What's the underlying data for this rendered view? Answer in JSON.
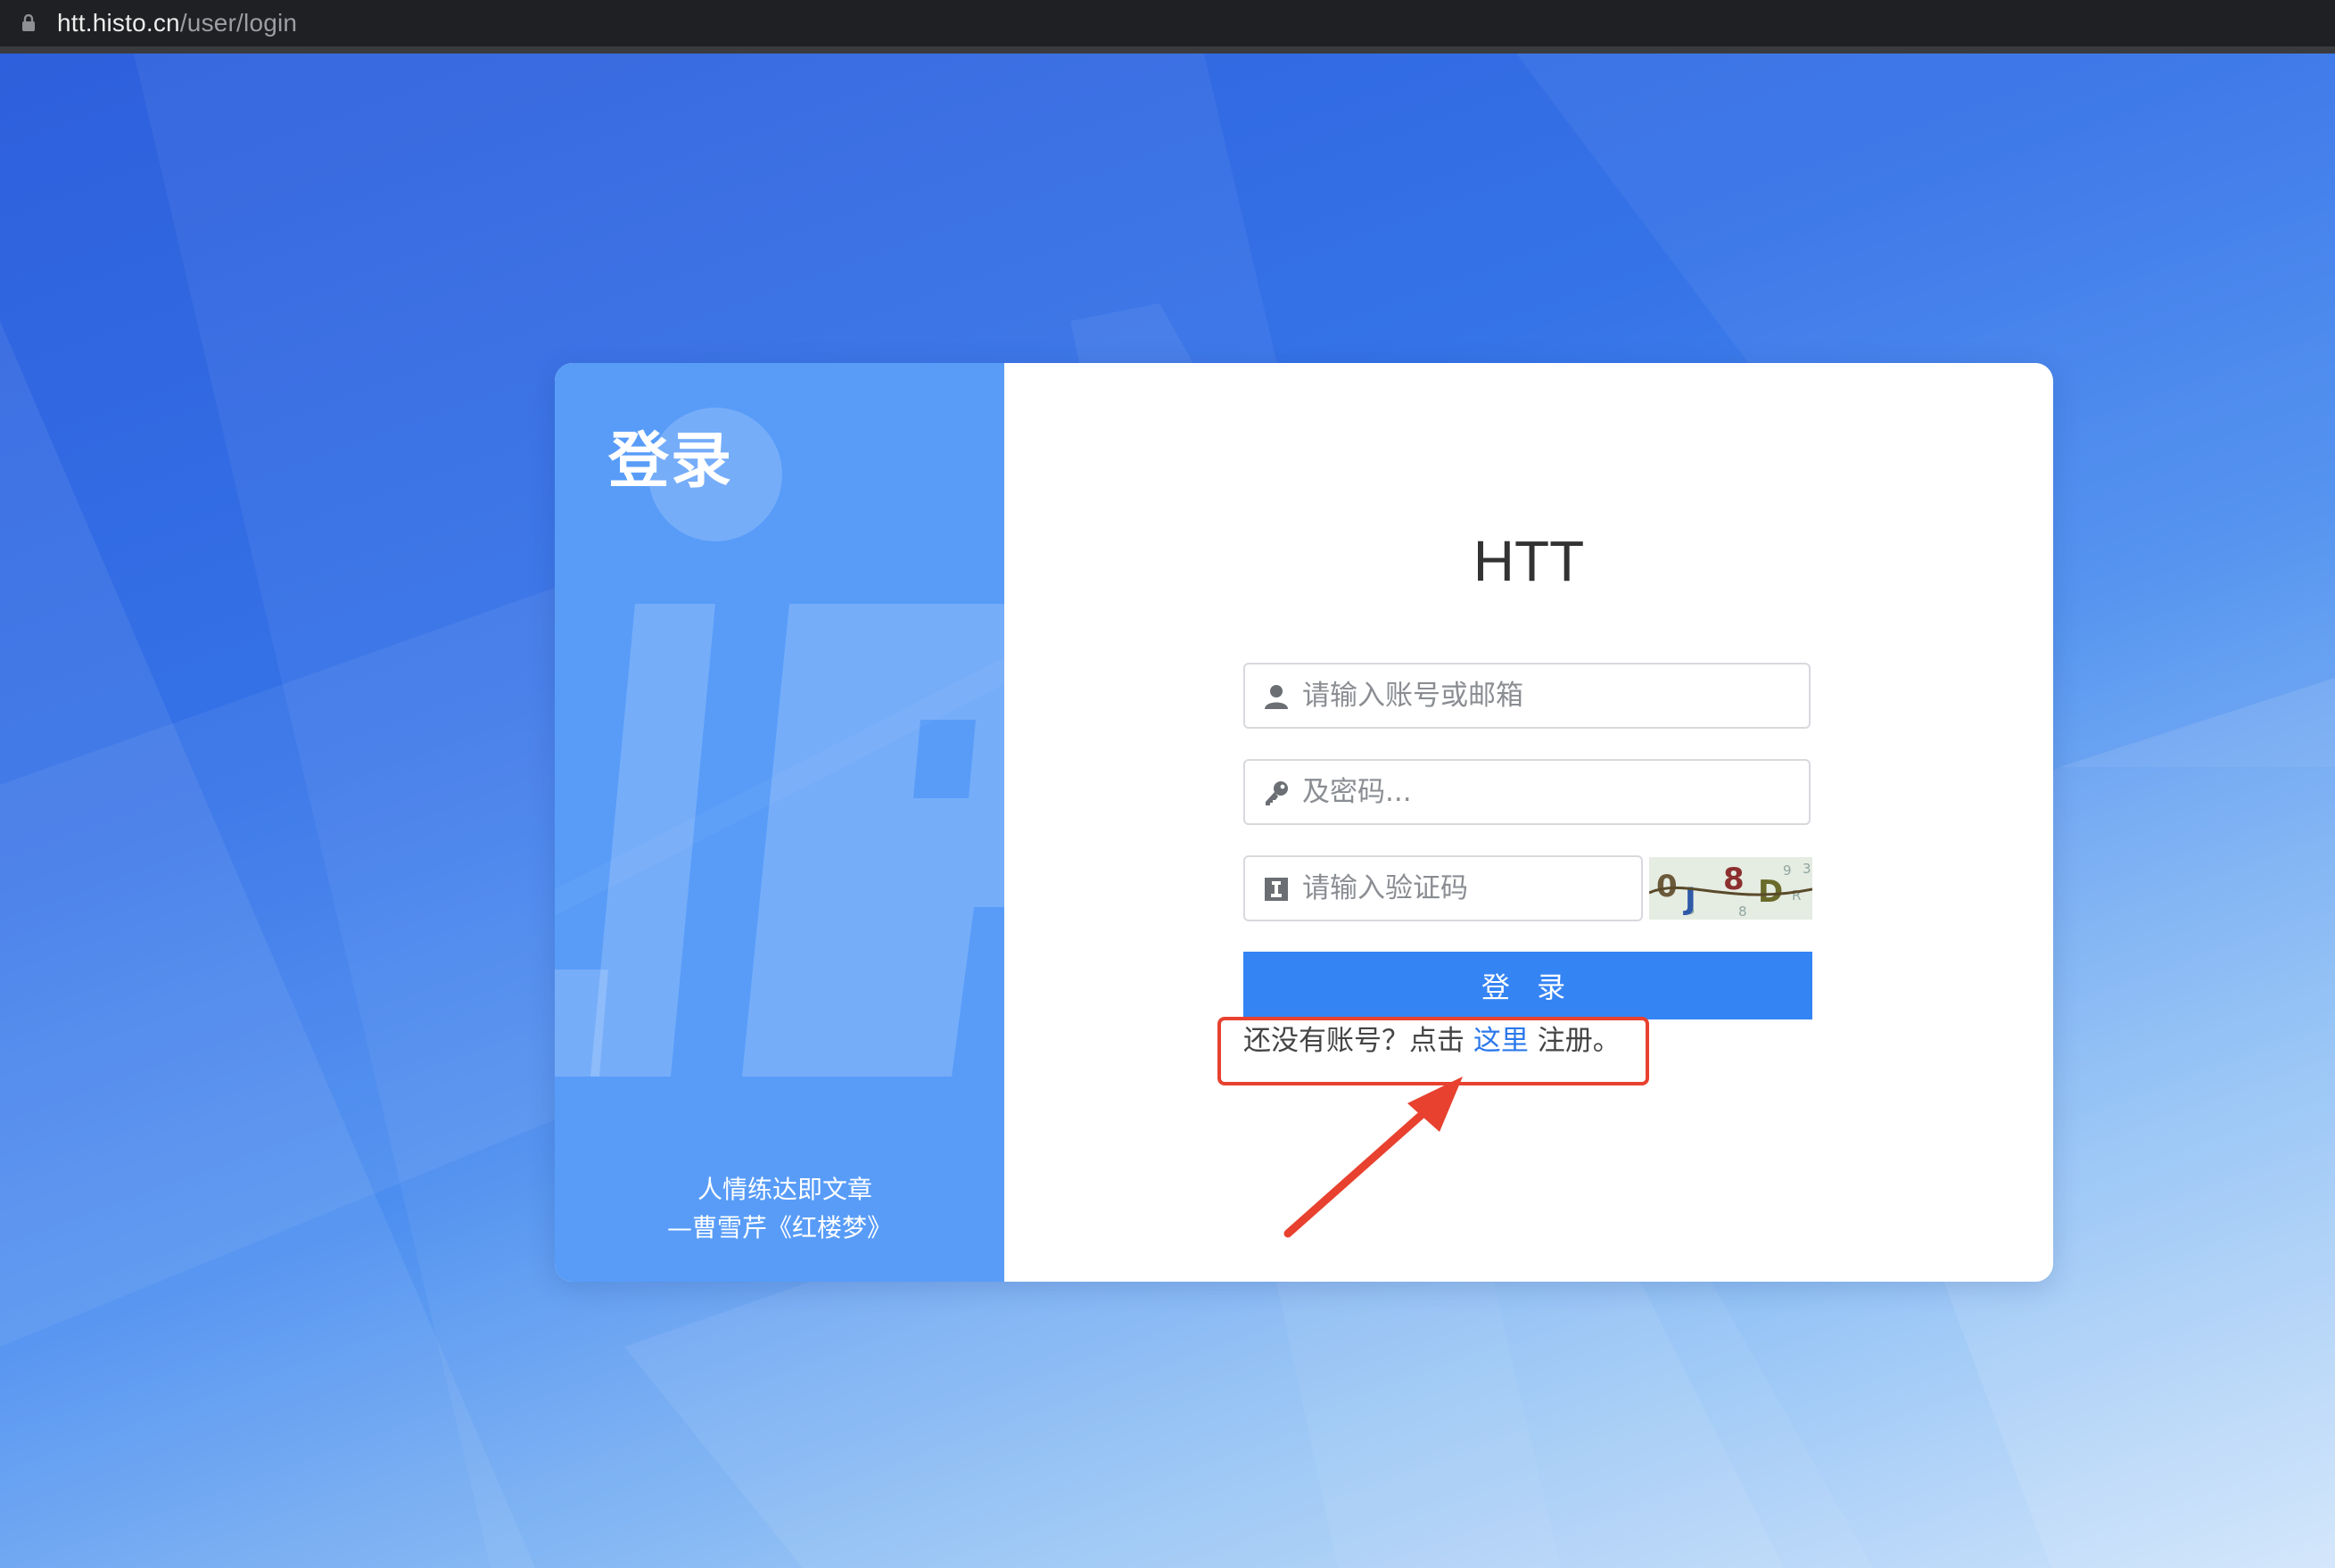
{
  "browser": {
    "url_host": "htt.histo.cn",
    "url_path": "/user/login"
  },
  "card": {
    "left_title": "登录",
    "quote_line1": "人情练达即文章",
    "quote_line2": "—曹雪芹《红楼梦》",
    "app_title": "HTT",
    "account_placeholder": "请输入账号或邮箱",
    "password_placeholder": "及密码...",
    "captcha_placeholder": "请输入验证码",
    "captcha_text": "0J8D",
    "login_button": "登 录",
    "register_prefix": "还没有账号？点击",
    "register_link": "这里",
    "register_suffix": "注册。"
  },
  "colors": {
    "accent": "#3584f4",
    "left_panel": "#589cf8",
    "annotation": "#e8412f",
    "link": "#2c78ea"
  },
  "icons": [
    "lock-icon",
    "user-icon",
    "key-icon",
    "captcha-icon",
    "arrow-annotation"
  ]
}
